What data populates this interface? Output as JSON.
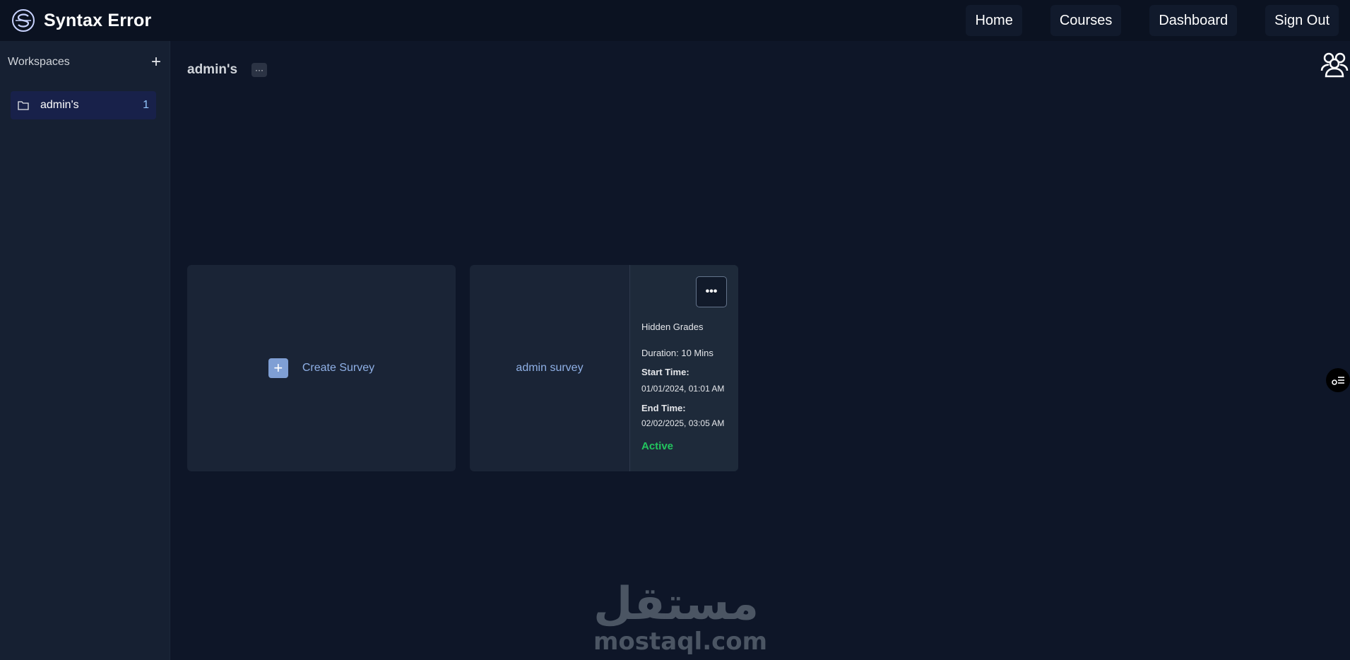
{
  "header": {
    "brand": "Syntax Error",
    "nav": [
      "Home",
      "Courses",
      "Dashboard",
      "Sign Out"
    ]
  },
  "sidebar": {
    "title": "Workspaces",
    "add_label": "+",
    "items": [
      {
        "label": "admin's",
        "count": "1"
      }
    ]
  },
  "main": {
    "workspace_title": "admin's",
    "menu_label": "···",
    "create_label": "Create Survey",
    "plus": "+",
    "survey": {
      "name": "admin survey",
      "more_label": "•••",
      "grades": "Hidden Grades",
      "duration": "Duration: 10 Mins",
      "start_label": "Start Time:",
      "start_value": "01/01/2024, 01:01 AM",
      "end_label": "End Time:",
      "end_value": "02/02/2025, 03:05 AM",
      "status": "Active"
    }
  },
  "watermark": {
    "arabic": "مستقل",
    "latin": "mostaql.com"
  },
  "colors": {
    "accent": "#8fb0e6",
    "active": "#22c55e",
    "background": "#0e1628",
    "sidebar": "#162032",
    "card": "#1a2436"
  }
}
